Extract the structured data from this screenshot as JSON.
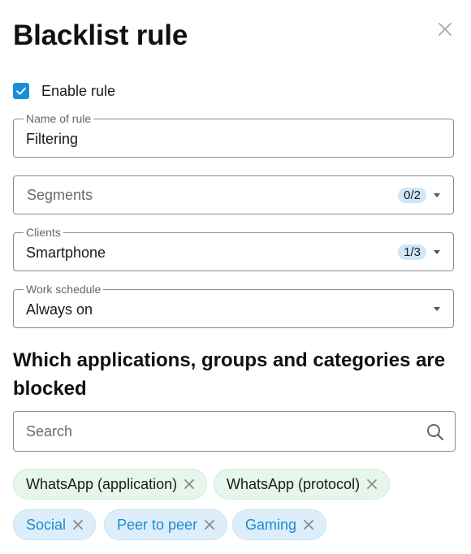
{
  "dialog": {
    "title": "Blacklist rule",
    "close_icon": "close-icon"
  },
  "enable_rule": {
    "label": "Enable rule",
    "checked": true
  },
  "fields": {
    "name": {
      "legend": "Name of rule",
      "value": "Filtering"
    },
    "segments": {
      "placeholder": "Segments",
      "count": "0/2"
    },
    "clients": {
      "legend": "Clients",
      "value": "Smartphone",
      "count": "1/3"
    },
    "schedule": {
      "legend": "Work schedule",
      "value": "Always on"
    }
  },
  "blocked": {
    "heading": "Which applications, groups and categories are blocked",
    "search_placeholder": "Search",
    "chips": [
      {
        "label": "WhatsApp (application)",
        "kind": "application"
      },
      {
        "label": "WhatsApp (protocol)",
        "kind": "application"
      },
      {
        "label": "Social",
        "kind": "category"
      },
      {
        "label": "Peer to peer",
        "kind": "category"
      },
      {
        "label": "Gaming",
        "kind": "category"
      }
    ]
  },
  "colors": {
    "accent": "#1a8fd6",
    "app_chip_bg": "#e6f6ec",
    "category_chip_bg": "#ddeefa",
    "category_chip_text": "#1c8ad4",
    "badge_bg": "#cfe7f7"
  }
}
